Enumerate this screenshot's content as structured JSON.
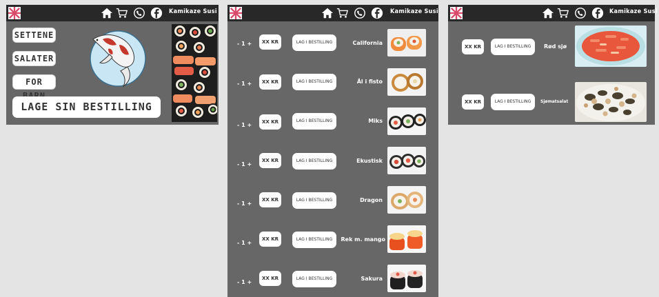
{
  "brand": "Kamikaze Susi",
  "icons": {
    "logo": "pinwheel-logo-icon",
    "home": "home-icon",
    "cart": "cart-icon",
    "phone": "phone-icon",
    "facebook": "facebook-icon"
  },
  "colors": {
    "topbar": "#282828",
    "panel": "#676767",
    "background": "#e4e4e4",
    "button": "#ffffff",
    "logo": "#d94a6a"
  },
  "home_page": {
    "menu": [
      "SETTENE",
      "SALATER",
      "FOR BARN"
    ],
    "order_button": "LAGE SIN BESTILLING"
  },
  "sushi_page": {
    "items": [
      {
        "qty": "- 1 +",
        "price": "XX KR",
        "order": "LAG I BESTILLING",
        "name": "California"
      },
      {
        "qty": "- 1 +",
        "price": "XX KR",
        "order": "LAG I BESTILLING",
        "name": "Ål i fisto"
      },
      {
        "qty": "- 1 +",
        "price": "XX KR",
        "order": "LAG I BESTILLING",
        "name": "Miks"
      },
      {
        "qty": "- 1 +",
        "price": "XX KR",
        "order": "LAG I BESTILLING",
        "name": "Ekustisk"
      },
      {
        "qty": "- 1 +",
        "price": "XX KR",
        "order": "LAG I BESTILLING",
        "name": "Dragon"
      },
      {
        "qty": "- 1 +",
        "price": "XX KR",
        "order": "LAG I BESTILLING",
        "name": "Rek m. mango"
      },
      {
        "qty": "- 1 +",
        "price": "XX KR",
        "order": "LAG I BESTILLING",
        "name": "Sakura"
      }
    ]
  },
  "salad_page": {
    "items": [
      {
        "price": "XX KR",
        "order": "LAG I BESTILLING",
        "name": "Rød sjø"
      },
      {
        "price": "XX KR",
        "order": "LAG I BESTILLING",
        "name": "Sjømatsalat"
      }
    ]
  }
}
